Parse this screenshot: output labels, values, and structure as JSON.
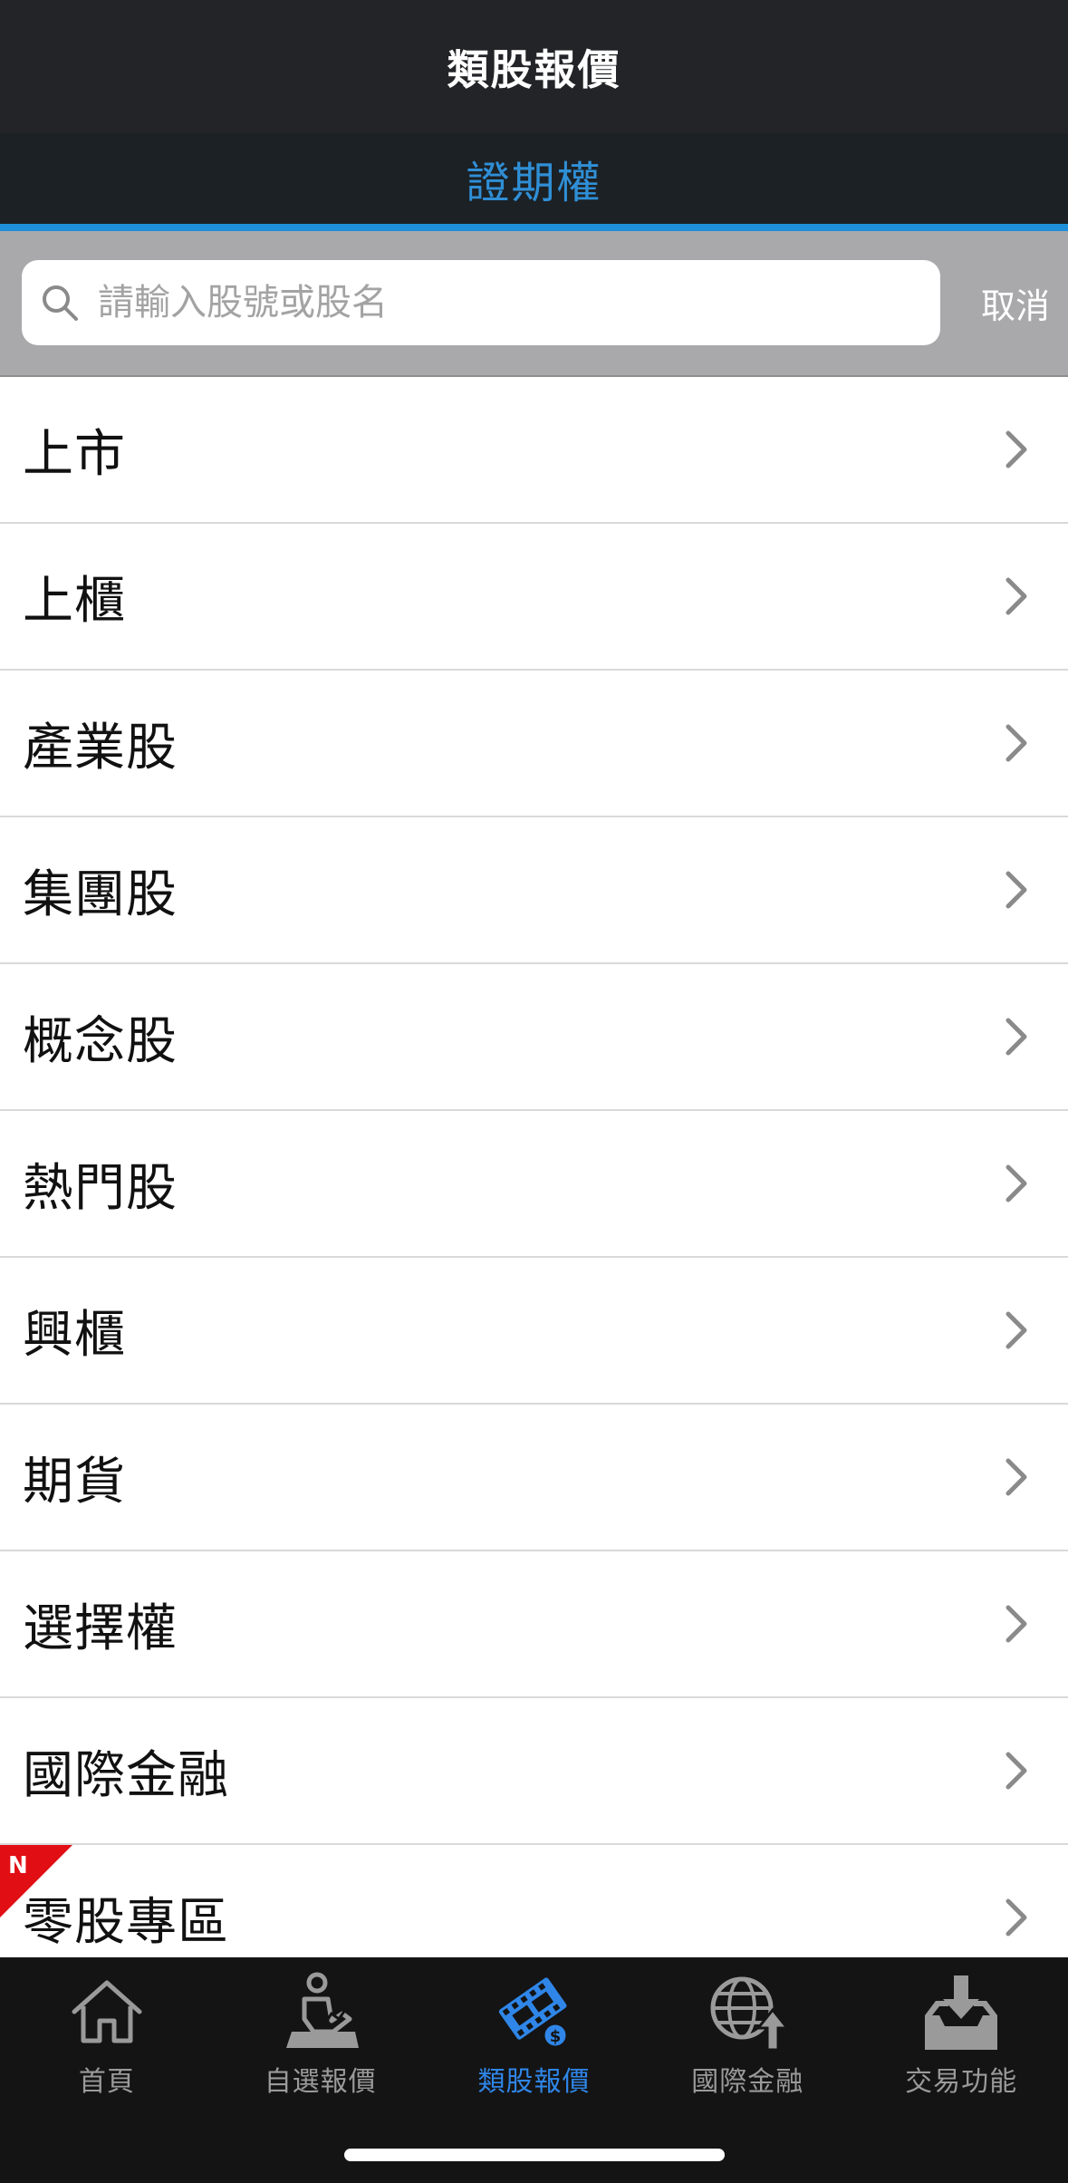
{
  "header": {
    "title": "類股報價"
  },
  "tab": {
    "label": "證期權"
  },
  "search": {
    "placeholder": "請輸入股號或股名",
    "value": "",
    "cancel_label": "取消"
  },
  "list": {
    "items": [
      {
        "label": "上市"
      },
      {
        "label": "上櫃"
      },
      {
        "label": "產業股"
      },
      {
        "label": "集團股"
      },
      {
        "label": "概念股"
      },
      {
        "label": "熱門股"
      },
      {
        "label": "興櫃"
      },
      {
        "label": "期貨"
      },
      {
        "label": "選擇權"
      },
      {
        "label": "國際金融"
      },
      {
        "label": "零股專區",
        "badge": "N"
      }
    ]
  },
  "bottom_nav": {
    "items": [
      {
        "label": "首頁",
        "icon": "home-icon"
      },
      {
        "label": "自選報價",
        "icon": "person-chart-icon"
      },
      {
        "label": "類股報價",
        "icon": "film-dollar-icon",
        "active": true
      },
      {
        "label": "國際金融",
        "icon": "globe-arrow-icon"
      },
      {
        "label": "交易功能",
        "icon": "inbox-download-icon"
      }
    ]
  },
  "colors": {
    "accent": "#2f8fd6",
    "nav_active": "#2f86e8",
    "badge": "#e10e14",
    "header_bg": "#232427"
  }
}
